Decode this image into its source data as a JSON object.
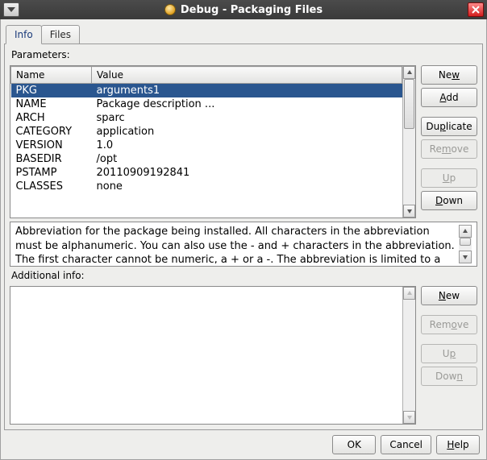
{
  "window": {
    "title": "Debug - Packaging Files"
  },
  "tabs": {
    "info": "Info",
    "files": "Files"
  },
  "parameters": {
    "label": "Parameters:",
    "columns": {
      "name": "Name",
      "value": "Value"
    },
    "rows": [
      {
        "name": "PKG",
        "value": "arguments1",
        "selected": true
      },
      {
        "name": "NAME",
        "value": "Package description ...",
        "selected": false
      },
      {
        "name": "ARCH",
        "value": "sparc",
        "selected": false
      },
      {
        "name": "CATEGORY",
        "value": "application",
        "selected": false
      },
      {
        "name": "VERSION",
        "value": "1.0",
        "selected": false
      },
      {
        "name": "BASEDIR",
        "value": "/opt",
        "selected": false
      },
      {
        "name": "PSTAMP",
        "value": "20110909192841",
        "selected": false
      },
      {
        "name": "CLASSES",
        "value": "none",
        "selected": false
      }
    ],
    "buttons": {
      "new": "New",
      "add": "Add",
      "duplicate": "Duplicate",
      "remove": "Remove",
      "up": "Up",
      "down": "Down"
    }
  },
  "description": "Abbreviation for the package being installed. All  characters in the abbreviation must be alphanumeric. You can also use the - and + characters in the abbreviation. The first character cannot be numeric, a + or a -.  The abbreviation is limited to a maximum",
  "additional": {
    "label": "Additional info:",
    "buttons": {
      "new": "New",
      "remove": "Remove",
      "up": "Up",
      "down": "Down"
    }
  },
  "dialog": {
    "ok": "OK",
    "cancel": "Cancel",
    "help": "Help"
  }
}
